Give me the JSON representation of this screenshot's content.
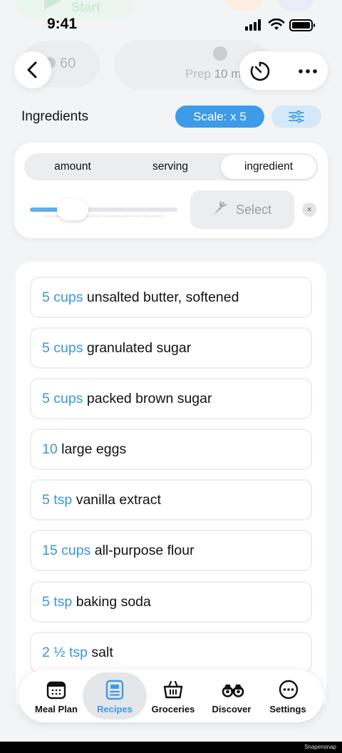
{
  "ghost": {
    "start_label": "Start"
  },
  "status": {
    "time": "9:41"
  },
  "header": {
    "servings_count": "60",
    "prep_label": "Prep",
    "prep_value": "10 m"
  },
  "ingredients": {
    "title": "Ingredients",
    "scale_label": "Scale: x 5"
  },
  "controls": {
    "segments": [
      "amount",
      "serving",
      "ingredient"
    ],
    "active_segment": "ingredient",
    "slider_fraction": 0.3,
    "select_label": "Select",
    "clear_symbol": "×"
  },
  "items": [
    {
      "amount": "5 cups",
      "name": "unsalted butter, softened"
    },
    {
      "amount": "5 cups",
      "name": "granulated sugar"
    },
    {
      "amount": "5 cups",
      "name": "packed brown sugar"
    },
    {
      "amount": "10",
      "name": "large eggs"
    },
    {
      "amount": "5 tsp",
      "name": "vanilla extract"
    },
    {
      "amount": "15 cups",
      "name": "all-purpose flour"
    },
    {
      "amount": "5 tsp",
      "name": "baking soda"
    },
    {
      "amount": "2 ½ tsp",
      "name": "salt"
    }
  ],
  "nav": [
    {
      "label": "Meal Plan",
      "icon": "calendar-icon"
    },
    {
      "label": "Recipes",
      "icon": "recipe-card-icon",
      "active": true
    },
    {
      "label": "Groceries",
      "icon": "basket-icon"
    },
    {
      "label": "Discover",
      "icon": "binoculars-icon"
    },
    {
      "label": "Settings",
      "icon": "ellipsis-circle-icon"
    }
  ],
  "colors": {
    "accent": "#3d9be9",
    "amount": "#3a95dc"
  },
  "watermark": "Snapensnap"
}
